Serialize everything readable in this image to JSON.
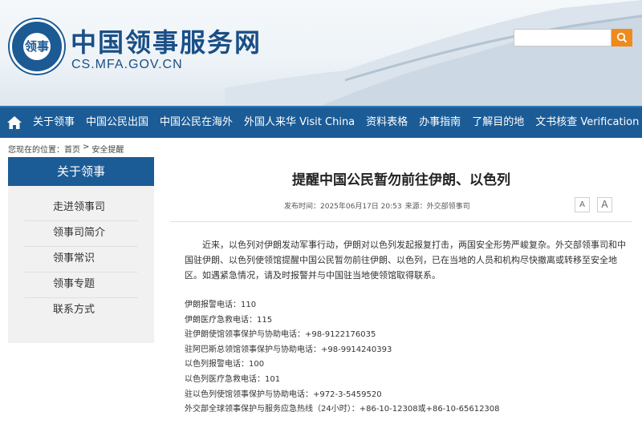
{
  "header": {
    "logo_text": "领事",
    "site_title": "中国领事服务网",
    "site_domain": "CS.MFA.GOV.CN",
    "search_placeholder": ""
  },
  "nav": {
    "items": [
      "关于领事",
      "中国公民出国",
      "中国公民在海外",
      "外国人来华 Visit China",
      "资料表格",
      "办事指南",
      "了解目的地",
      "文书核查 Verification"
    ]
  },
  "breadcrumb": {
    "prefix": "您现在的位置：",
    "home": "首页",
    "sep": ">",
    "current": "安全提醒"
  },
  "sidebar": {
    "heading": "关于领事",
    "items": [
      "走进领事司",
      "领事司简介",
      "领事常识",
      "领事专题",
      "联系方式"
    ]
  },
  "article": {
    "title": "提醒中国公民暂勿前往伊朗、以色列",
    "meta_time": "发布时间：2025年06月17日 20:53",
    "meta_source": "来源：外交部领事司",
    "font_small": "A",
    "font_large": "A",
    "paragraph": "近来，以色列对伊朗发动军事行动，伊朗对以色列发起报复打击，两国安全形势严峻复杂。外交部领事司和中国驻伊朗、以色列使领馆提醒中国公民暂勿前往伊朗、以色列，已在当地的人员和机构尽快撤离或转移至安全地区。如遇紧急情况，请及时报警并与中国驻当地使领馆取得联系。",
    "contacts": [
      "伊朗报警电话：110",
      "伊朗医疗急救电话：115",
      "驻伊朗使馆领事保护与协助电话：+98-9122176035",
      "驻阿巴斯总领馆领事保护与协助电话：+98-9914240393",
      "以色列报警电话：100",
      "以色列医疗急救电话：101",
      "驻以色列使馆领事保护与协助电话：+972-3-5459520",
      "外交部全球领事保护与服务应急热线（24小时）：+86-10-12308或+86-10-65612308"
    ]
  },
  "colors": {
    "brand_blue": "#1c5c96",
    "search_orange": "#f08a1c"
  }
}
